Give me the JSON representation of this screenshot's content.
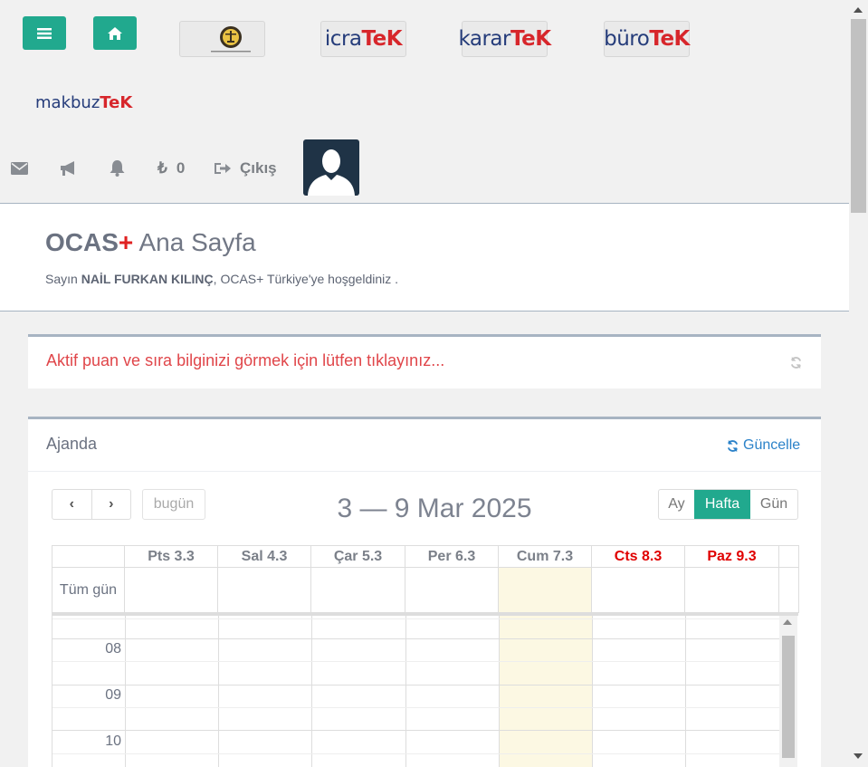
{
  "header": {
    "menu_icon": "hamburger-icon",
    "home_icon": "home-icon",
    "logos": {
      "icratek": {
        "dark": "icra",
        "red": "TeK"
      },
      "karartek": {
        "dark": "karar",
        "red": "TeK"
      },
      "burotek": {
        "dark": "büro",
        "red": "TeK"
      },
      "makbuztek": {
        "dark": "makbuz",
        "red": "TeK"
      }
    }
  },
  "topbar": {
    "balance": "0",
    "logout_label": "Çıkış"
  },
  "page": {
    "title_main": "OCAS",
    "title_plus": "+",
    "title_sub": "Ana Sayfa",
    "welcome_prefix": "Sayın ",
    "user_name": "NAİL FURKAN KILINÇ",
    "welcome_suffix": ", OCAS+ Türkiye'ye hoşgeldiniz ."
  },
  "alert": {
    "text": "Aktif puan ve sıra bilginizi görmek için lütfen tıklayınız..."
  },
  "agenda": {
    "title": "Ajanda",
    "refresh_label": "Güncelle",
    "today_label": "bugün",
    "range_title": "3 — 9 Mar 2025",
    "views": [
      "Ay",
      "Hafta",
      "Gün"
    ],
    "active_view": "Hafta",
    "allday_label": "Tüm gün",
    "days": [
      {
        "label": "Pts 3.3",
        "weekend": false
      },
      {
        "label": "Sal 4.3",
        "weekend": false
      },
      {
        "label": "Çar 5.3",
        "weekend": false
      },
      {
        "label": "Per 6.3",
        "weekend": false
      },
      {
        "label": "Cum 7.3",
        "weekend": false,
        "today": true
      },
      {
        "label": "Cts 8.3",
        "weekend": true
      },
      {
        "label": "Paz 9.3",
        "weekend": true
      }
    ],
    "hours": [
      "08",
      "09",
      "10"
    ]
  },
  "colors": {
    "accent": "#21a98e",
    "brand_red": "#e02222",
    "weekend_red": "#e00000",
    "today_bg": "#fcf8e3",
    "link_blue": "#2b82c9"
  }
}
